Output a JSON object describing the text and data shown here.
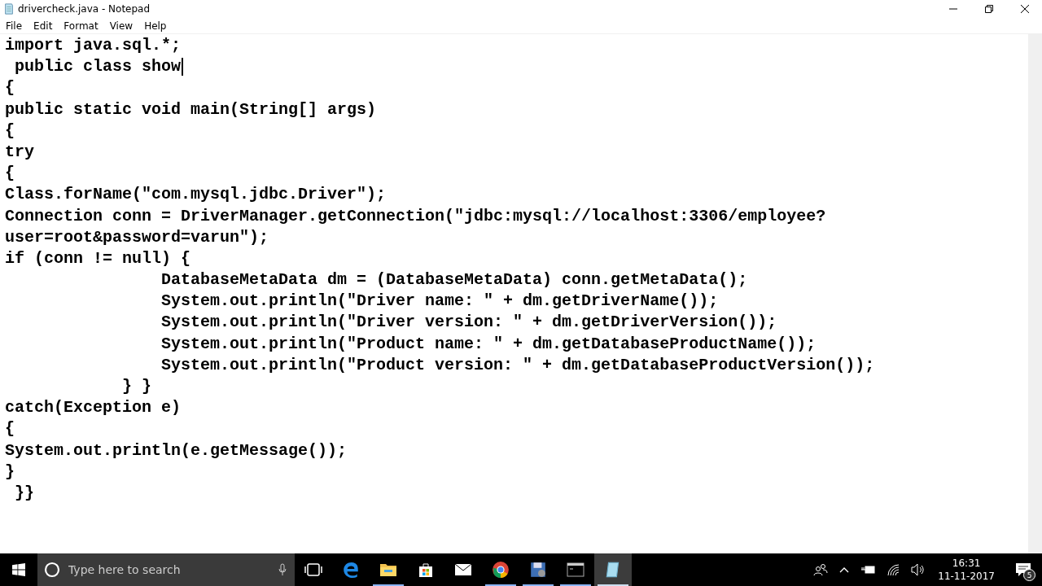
{
  "window": {
    "title": "drivercheck.java - Notepad"
  },
  "menu": [
    "File",
    "Edit",
    "Format",
    "View",
    "Help"
  ],
  "editor": {
    "lines": [
      {
        "text": "import java.sql.*;",
        "cursor": false
      },
      {
        "text": " public class show",
        "cursor": true
      },
      {
        "text": "{",
        "cursor": false
      },
      {
        "text": "public static void main(String[] args)",
        "cursor": false
      },
      {
        "text": "{",
        "cursor": false
      },
      {
        "text": "try",
        "cursor": false
      },
      {
        "text": "{",
        "cursor": false
      },
      {
        "text": "Class.forName(\"com.mysql.jdbc.Driver\");",
        "cursor": false
      },
      {
        "text": "Connection conn = DriverManager.getConnection(\"jdbc:mysql://localhost:3306/employee?",
        "cursor": false
      },
      {
        "text": "user=root&password=varun\");",
        "cursor": false
      },
      {
        "text": "if (conn != null) {",
        "cursor": false
      },
      {
        "text": "                DatabaseMetaData dm = (DatabaseMetaData) conn.getMetaData();",
        "cursor": false
      },
      {
        "text": "                System.out.println(\"Driver name: \" + dm.getDriverName());",
        "cursor": false
      },
      {
        "text": "                System.out.println(\"Driver version: \" + dm.getDriverVersion());",
        "cursor": false
      },
      {
        "text": "                System.out.println(\"Product name: \" + dm.getDatabaseProductName());",
        "cursor": false
      },
      {
        "text": "                System.out.println(\"Product version: \" + dm.getDatabaseProductVersion());",
        "cursor": false
      },
      {
        "text": "            } }",
        "cursor": false
      },
      {
        "text": "catch(Exception e)",
        "cursor": false
      },
      {
        "text": "{",
        "cursor": false
      },
      {
        "text": "System.out.println(e.getMessage());",
        "cursor": false
      },
      {
        "text": "}",
        "cursor": false
      },
      {
        "text": " }}",
        "cursor": false
      }
    ]
  },
  "taskbar": {
    "search": {
      "placeholder": "Type here to search"
    },
    "apps": [
      {
        "kind": "taskview",
        "running": false,
        "selected": false
      },
      {
        "kind": "edge",
        "running": false,
        "selected": false
      },
      {
        "kind": "explorer",
        "running": true,
        "selected": false
      },
      {
        "kind": "store",
        "running": false,
        "selected": false
      },
      {
        "kind": "mail",
        "running": false,
        "selected": false
      },
      {
        "kind": "chrome",
        "running": true,
        "selected": false
      },
      {
        "kind": "floppy",
        "running": true,
        "selected": false
      },
      {
        "kind": "console",
        "running": true,
        "selected": false
      },
      {
        "kind": "notepad",
        "running": true,
        "selected": true
      }
    ],
    "time": "16:31",
    "date": "11-11-2017",
    "notifications": "5"
  }
}
